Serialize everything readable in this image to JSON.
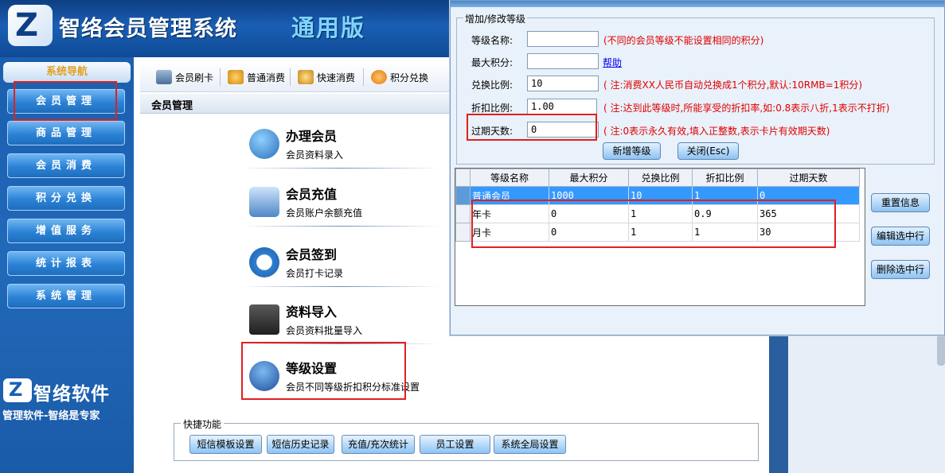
{
  "header": {
    "app_title": "智络会员管理系统",
    "app_edition": "通用版"
  },
  "sidebar": {
    "title": "系统导航",
    "items": [
      {
        "label": "会员管理"
      },
      {
        "label": "商品管理"
      },
      {
        "label": "会员消费"
      },
      {
        "label": "积分兑换"
      },
      {
        "label": "增值服务"
      },
      {
        "label": "统计报表"
      },
      {
        "label": "系统管理"
      }
    ],
    "brand_name": "智络软件",
    "brand_slogan": "管理软件-智络是专家"
  },
  "toolbar": {
    "items": [
      {
        "label": "会员刷卡",
        "icon": "card-swipe-icon"
      },
      {
        "label": "普通消费",
        "icon": "money-bag-icon"
      },
      {
        "label": "快速消费",
        "icon": "coins-icon"
      },
      {
        "label": "积分兑换",
        "icon": "exchange-icon"
      }
    ]
  },
  "main": {
    "header_title": "会员管理",
    "features": [
      {
        "title": "办理会员",
        "subtitle": "会员资料录入",
        "icon": "member-register-icon"
      },
      {
        "title": "会员充值",
        "subtitle": "会员账户余额充值",
        "icon": "recharge-card-icon"
      },
      {
        "title": "会员签到",
        "subtitle": "会员打卡记录",
        "icon": "checkin-clock-icon"
      },
      {
        "title": "资料导入",
        "subtitle": "会员资料批量导入",
        "icon": "laptop-import-icon"
      },
      {
        "title": "等级设置",
        "subtitle": "会员不同等级折扣积分标准设置",
        "icon": "level-user-icon"
      }
    ],
    "quick": {
      "legend": "快捷功能",
      "buttons": [
        "短信模板设置",
        "短信历史记录",
        "充值/充次统计",
        "员工设置",
        "系统全局设置"
      ]
    }
  },
  "dialog": {
    "group_legend": "增加/修改等级",
    "fields": {
      "level_name": {
        "label": "等级名称:",
        "value": "",
        "note": "(不同的会员等级不能设置相同的积分)"
      },
      "max_points": {
        "label": "最大积分:",
        "value": "",
        "link": "帮助"
      },
      "ratio": {
        "label": "兑换比例:",
        "value": "10",
        "note": "( 注:消费XX人民币自动兑换成1个积分,默认:10RMB=1积分)"
      },
      "discount": {
        "label": "折扣比例:",
        "value": "1.00",
        "note": "( 注:达到此等级时,所能享受的折扣率,如:0.8表示八折,1表示不打折)"
      },
      "expire": {
        "label": "过期天数:",
        "value": "0",
        "note": "( 注:0表示永久有效,填入正整数,表示卡片有效期天数)"
      }
    },
    "buttons": {
      "add": "新增等级",
      "close": "关闭(Esc)",
      "reset": "重置信息",
      "edit": "编辑选中行",
      "delete": "删除选中行"
    },
    "grid": {
      "columns": [
        "等级名称",
        "最大积分",
        "兑换比例",
        "折扣比例",
        "过期天数"
      ],
      "rows": [
        [
          "普通会员",
          "1000",
          "10",
          "1",
          "0"
        ],
        [
          "年卡",
          "0",
          "1",
          "0.9",
          "365"
        ],
        [
          "月卡",
          "0",
          "1",
          "1",
          "30"
        ]
      ],
      "selected_row": 0
    }
  },
  "colors": {
    "header_blue": "#1a5fb4",
    "highlight_red": "#e02020",
    "note_red": "#e00000",
    "selection_blue": "#3399ff"
  }
}
